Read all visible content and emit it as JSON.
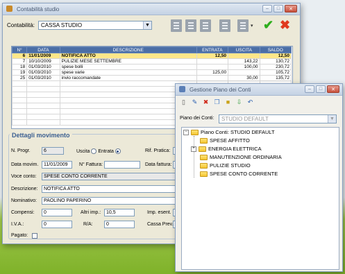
{
  "main_window": {
    "title": "Contabilità studio",
    "contabilita_label": "Contabilità:",
    "contabilita_value": "CASSA STUDIO",
    "table": {
      "headers": [
        "N°",
        "DATA",
        "DESCRIZIONE",
        "ENTRATA",
        "USCITA",
        "SALDO"
      ],
      "rows": [
        {
          "n": "6",
          "data": "11/01/2009",
          "desc": "NOTIFICA ATTO",
          "entrata": "12,50",
          "uscita": "",
          "saldo": "12,50",
          "selected": true
        },
        {
          "n": "7",
          "data": "10/10/2009",
          "desc": "PULIZIE MESE SETTEMBRE",
          "entrata": "",
          "uscita": "143,22",
          "saldo": "130,72",
          "selected": false
        },
        {
          "n": "18",
          "data": "01/03/2010",
          "desc": "spese bolli",
          "entrata": "",
          "uscita": "100,00",
          "saldo": "230,72",
          "selected": false
        },
        {
          "n": "19",
          "data": "01/03/2010",
          "desc": "spese varie",
          "entrata": "125,00",
          "uscita": "",
          "saldo": "105,72",
          "selected": false
        },
        {
          "n": "25",
          "data": "01/03/2010",
          "desc": "invio raccomandate",
          "entrata": "",
          "uscita": "30,00",
          "saldo": "135,72",
          "selected": false
        }
      ]
    },
    "details": {
      "title": "Dettagli movimento",
      "nprogr_label": "N. Progr.",
      "nprogr_value": "6",
      "uscita_label": "Uscita",
      "entrata_label": "Entrata",
      "rif_label": "Rif. Pratica:",
      "data_label": "Data movim.",
      "data_value": "11/01/2009",
      "fattura_label": "N° Fattura:",
      "datafattura_label": "Data fattura:",
      "voce_label": "Voce conto:",
      "voce_value": "SPESE CONTO CORRENTE",
      "descrizione_label": "Descrizione:",
      "descrizione_value": "NOTIFICA ATTO",
      "nominativo_label": "Nominativo:",
      "nominativo_value": "PAOLINO PAPERINO",
      "compensi_label": "Compensi:",
      "compensi_value": "0",
      "altri_label": "Altri imp.:",
      "altri_value": "10,5",
      "imp_label": "Imp. esent.",
      "imp_value": "2",
      "iva_label": "I.V.A.:",
      "iva_value": "0",
      "ra_label": "R/A:",
      "ra_value": "0",
      "cassa_label": "Cassa Prev.:",
      "pagato_label": "Pagato:"
    }
  },
  "piano_window": {
    "title": "Gestione Piano dei Conti",
    "piano_label": "Piano dei Conti:",
    "piano_value": "STUDIO DEFAULT",
    "tree": {
      "root": "Piano Conti: STUDIO DEFAULT",
      "items": [
        "SPESE AFFITTO",
        "ENERGIA ELETTRICA",
        "MANUTENZIONE ORDINARIA",
        "PULIZIE STUDIO",
        "SPESE CONTO CORRENTE"
      ]
    }
  }
}
